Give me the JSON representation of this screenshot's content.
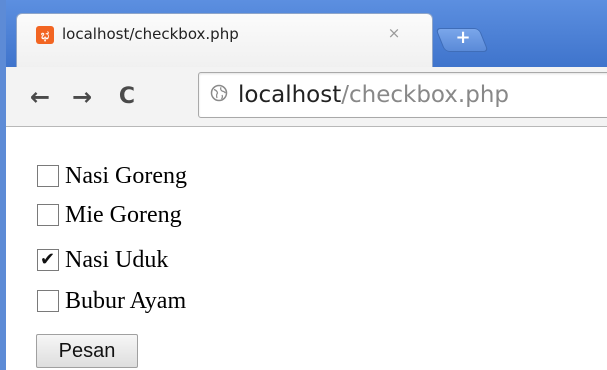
{
  "browser": {
    "tab_title": "localhost/checkbox.php",
    "tab_close_glyph": "×",
    "new_tab_glyph": "+",
    "url_host": "localhost",
    "url_path": "/checkbox.php",
    "back_glyph": "←",
    "forward_glyph": "→",
    "reload_glyph": "C",
    "favicon_glyph": "ಭ"
  },
  "form": {
    "options": [
      {
        "label": "Nasi Goreng",
        "checked": false
      },
      {
        "label": "Mie Goreng",
        "checked": false
      },
      {
        "label": "Nasi Uduk",
        "checked": true
      },
      {
        "label": "Bubur Ayam",
        "checked": false
      }
    ],
    "submit_label": "Pesan"
  },
  "icons": {
    "favicon": "xampp-favicon",
    "security": "globe-icon",
    "new_tab": "new-tab-icon",
    "close_tab": "close-icon"
  },
  "colors": {
    "tabstrip": "#4f82d8",
    "favicon": "#f26522"
  }
}
